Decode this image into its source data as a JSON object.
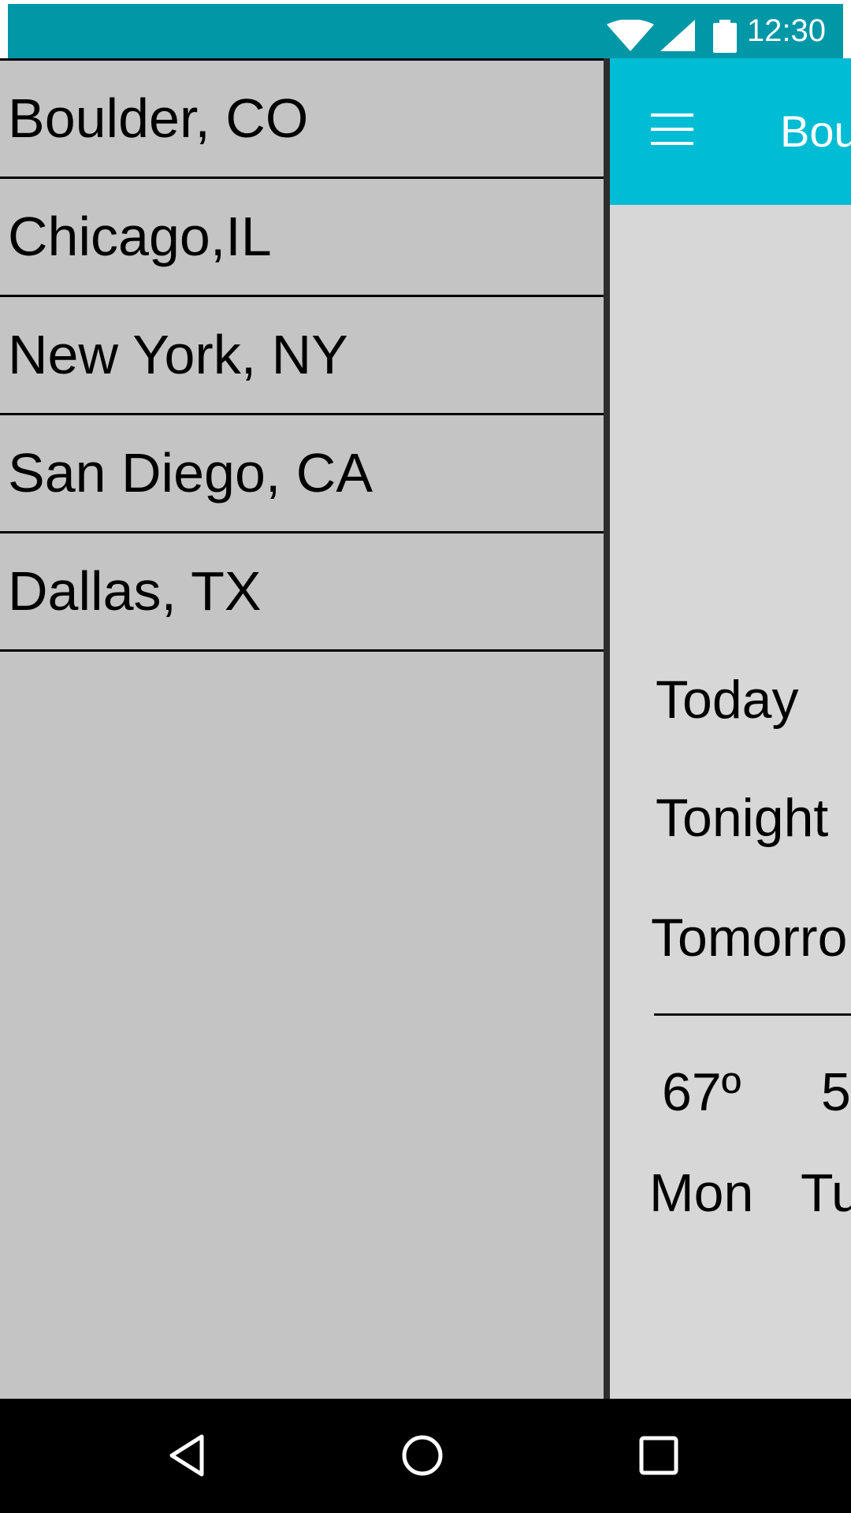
{
  "status_bar": {
    "time": "12:30",
    "icons": [
      "wifi-icon",
      "signal-icon",
      "battery-icon"
    ],
    "color": "#0097a7"
  },
  "toolbar": {
    "title": "Bou",
    "menu_icon": "hamburger-menu-icon",
    "color": "#00bcd4"
  },
  "drawer": {
    "cities": [
      {
        "label": "Boulder, CO"
      },
      {
        "label": "Chicago,IL"
      },
      {
        "label": "New York, NY"
      },
      {
        "label": "San Diego, CA"
      },
      {
        "label": "Dallas, TX"
      }
    ]
  },
  "forecast": {
    "periods": [
      {
        "label": "Today"
      },
      {
        "label": "Tonight"
      },
      {
        "label": "Tomorro"
      }
    ],
    "days": [
      {
        "temp": "67º",
        "name": "Mon"
      },
      {
        "temp": "5",
        "name": "Tu"
      }
    ]
  },
  "nav_bar": {
    "icons": [
      "back-icon",
      "home-icon",
      "recents-icon"
    ]
  }
}
